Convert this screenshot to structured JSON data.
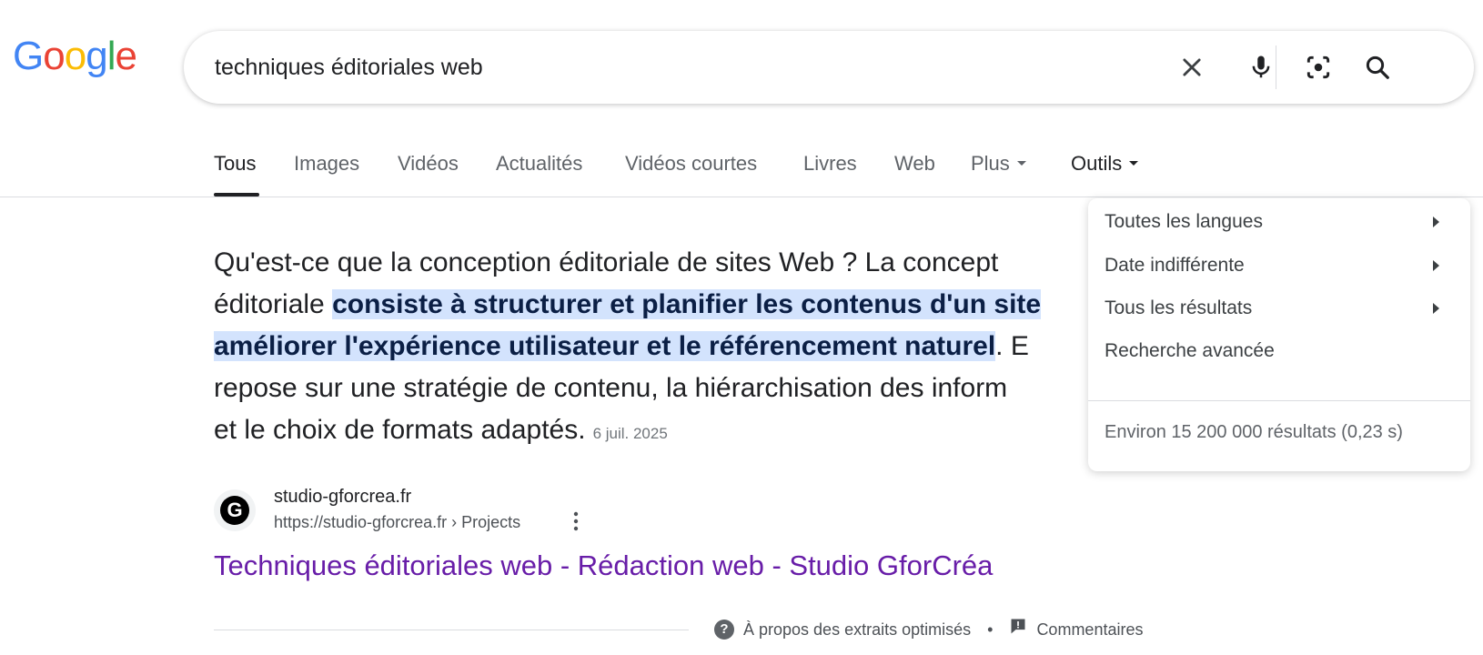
{
  "logo": {
    "letters": [
      "G",
      "o",
      "o",
      "g",
      "l",
      "e"
    ],
    "colors": [
      "#4285F4",
      "#EA4335",
      "#FBBC05",
      "#4285F4",
      "#34A853",
      "#EA4335"
    ]
  },
  "search": {
    "query": "techniques éditoriales web",
    "icons": [
      "close-icon",
      "microphone-icon",
      "lens-icon",
      "search-icon"
    ]
  },
  "tabs": {
    "items": [
      {
        "label": "Tous",
        "active": true
      },
      {
        "label": "Images"
      },
      {
        "label": "Vidéos"
      },
      {
        "label": "Actualités"
      },
      {
        "label": "Vidéos courtes"
      },
      {
        "label": "Livres"
      },
      {
        "label": "Web"
      },
      {
        "label": "Plus"
      },
      {
        "label": "Outils"
      }
    ]
  },
  "snippet": {
    "line1": "Qu'est-ce que la conception éditoriale de sites Web ? La concept",
    "line2_pre": "éditoriale ",
    "line2_hl": "consiste à structurer et planifier les contenus d'un site",
    "line3_hl": "améliorer l'expérience utilisateur et le référencement naturel",
    "line3_post": ". E",
    "line4": "repose sur une stratégie de contenu, la hiérarchisation des inform",
    "line5": "et le choix de formats adaptés.",
    "date": "6 juil. 2025"
  },
  "source": {
    "favicon_letter": "G",
    "site_name": "studio-gforcrea.fr",
    "url": "https://studio-gforcrea.fr › Projects",
    "title": "Techniques éditoriales web - Rédaction web - Studio GforCréa"
  },
  "footer": {
    "about": "À propos des extraits optimisés",
    "separator": "•",
    "feedback": "Commentaires"
  },
  "tools_menu": {
    "items": [
      {
        "label": "Toutes les langues",
        "has_submenu": true
      },
      {
        "label": "Date indifférente",
        "has_submenu": true
      },
      {
        "label": "Tous les résultats",
        "has_submenu": true
      },
      {
        "label": "Recherche avancée",
        "has_submenu": false
      }
    ],
    "stats": "Environ 15 200 000 résultats (0,23 s)"
  },
  "colors": {
    "highlight": "#d3e3fd",
    "visited_link": "#681da8"
  }
}
